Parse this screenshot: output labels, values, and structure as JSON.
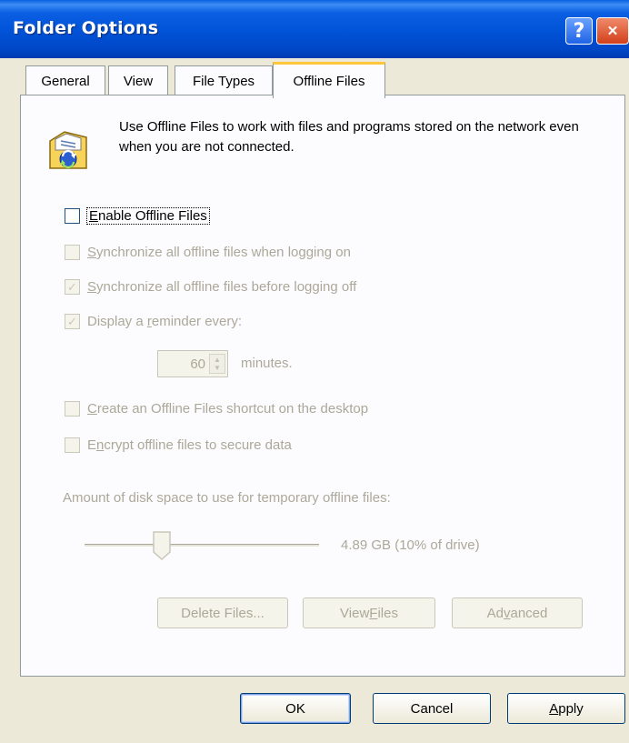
{
  "window": {
    "title": "Folder Options",
    "help_glyph": "?",
    "close_glyph": "✕"
  },
  "tabs": [
    {
      "label": "General",
      "active": false
    },
    {
      "label": "View",
      "active": false
    },
    {
      "label": "File Types",
      "active": false
    },
    {
      "label": "Offline Files",
      "active": true
    }
  ],
  "offline": {
    "intro": "Use Offline Files to work with files and programs stored on the network even when you are not connected.",
    "icon": "offline-folder-icon",
    "enable": {
      "prefix": "",
      "accel": "E",
      "rest": "nable Offline Files",
      "checked": false
    },
    "sync_logon": {
      "accel": "S",
      "rest": "ynchronize all offline files when logging on",
      "checked": false
    },
    "sync_logoff": {
      "accel": "S",
      "rest": "ynchronize all offline files before logging off",
      "checked": true
    },
    "reminder": {
      "pre": "Display a ",
      "accel": "r",
      "rest": "eminder every:",
      "checked": true
    },
    "reminder_value": "60",
    "reminder_unit": "minutes.",
    "shortcut": {
      "accel": "C",
      "rest": "reate an Offline Files shortcut on the desktop",
      "checked": false
    },
    "encrypt": {
      "pre": "E",
      "accel": "n",
      "rest": "crypt offline files to secure data",
      "checked": false
    },
    "disk_label": "Amount of disk space to use for temporary offline files:",
    "disk_value": "4.89 GB (10% of drive)",
    "disk_fraction": 0.1,
    "buttons": {
      "delete_files": "Delete Files...",
      "view_files_pre": "View ",
      "view_files_accel": "F",
      "view_files_rest": "iles",
      "advanced_pre": "Ad",
      "advanced_accel": "v",
      "advanced_rest": "anced"
    },
    "check_glyph": "✓"
  },
  "footer": {
    "ok": "OK",
    "cancel": "Cancel",
    "apply_accel": "A",
    "apply_rest": "pply"
  }
}
